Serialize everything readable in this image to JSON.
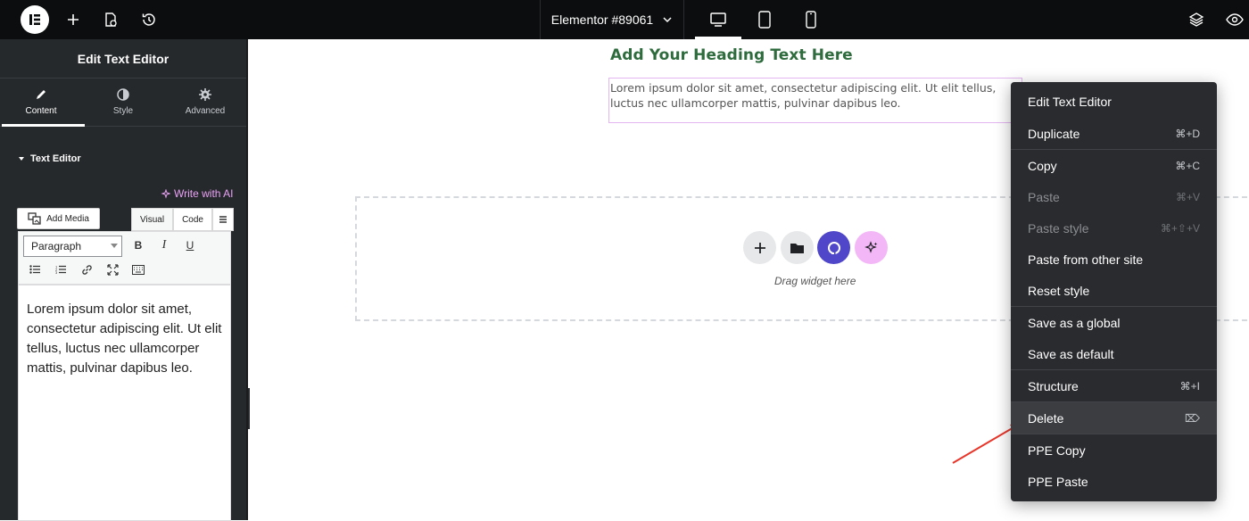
{
  "topbar": {
    "document_title": "Elementor #89061"
  },
  "panel": {
    "title": "Edit Text Editor",
    "tabs": [
      {
        "label": "Content",
        "icon": "pencil-icon"
      },
      {
        "label": "Style",
        "icon": "half-circle-icon"
      },
      {
        "label": "Advanced",
        "icon": "gear-icon"
      }
    ],
    "section_title": "Text Editor",
    "ai_link": "Write with AI",
    "add_media": "Add Media",
    "modes": [
      "Visual",
      "Code"
    ],
    "format_select": "Paragraph",
    "editor_text": "Lorem ipsum dolor sit amet, consectetur adipiscing elit. Ut elit tellus, luctus nec ullamcorper mattis, pulvinar dapibus leo."
  },
  "canvas": {
    "heading": "Add Your Heading Text Here",
    "paragraph": "Lorem ipsum dolor sit amet, consectetur adipiscing elit. Ut elit tellus, luctus nec ullamcorper mattis, pulvinar dapibus leo.",
    "drop_hint": "Drag widget here"
  },
  "context_menu": {
    "items": [
      {
        "label": "Edit Text Editor",
        "shortcut": ""
      },
      {
        "label": "Duplicate",
        "shortcut": "⌘+D"
      },
      {
        "label": "Copy",
        "shortcut": "⌘+C"
      },
      {
        "label": "Paste",
        "shortcut": "⌘+V"
      },
      {
        "label": "Paste style",
        "shortcut": "⌘+⇧+V"
      },
      {
        "label": "Paste from other site",
        "shortcut": ""
      },
      {
        "label": "Reset style",
        "shortcut": ""
      },
      {
        "label": "Save as a global",
        "shortcut": ""
      },
      {
        "label": "Save as default",
        "shortcut": ""
      },
      {
        "label": "Structure",
        "shortcut": "⌘+I"
      },
      {
        "label": "Delete",
        "shortcut": "⌦"
      },
      {
        "label": "PPE Copy",
        "shortcut": ""
      },
      {
        "label": "PPE Paste",
        "shortcut": ""
      }
    ]
  },
  "colors": {
    "topbar": "#0c0d0e",
    "panel": "#26292c",
    "heading": "#2e6b3d",
    "ai_accent": "#e9a1f5",
    "menu_bg": "#2a2b2e",
    "arrow": "#e8352a"
  }
}
